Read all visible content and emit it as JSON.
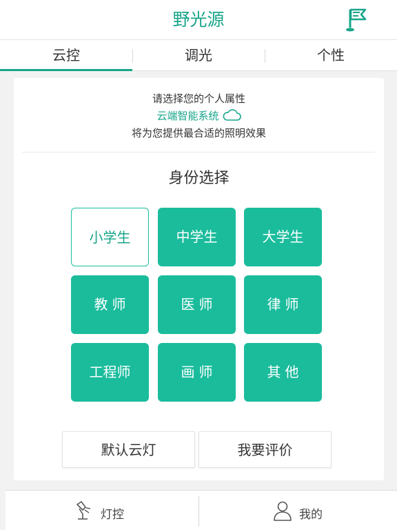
{
  "header": {
    "title": "野光源",
    "flag_icon": "flag-icon"
  },
  "tabs": [
    {
      "label": "云控",
      "active": true
    },
    {
      "label": "调光",
      "active": false
    },
    {
      "label": "个性",
      "active": false
    }
  ],
  "intro": {
    "line1": "请选择您的个人属性",
    "brand": "云端智能系统",
    "line3": "将为您提供最合适的照明效果"
  },
  "section_title": "身份选择",
  "identities": [
    {
      "label": "小学生",
      "selected": true
    },
    {
      "label": "中学生",
      "selected": false
    },
    {
      "label": "大学生",
      "selected": false
    },
    {
      "label": "教师",
      "selected": false
    },
    {
      "label": "医师",
      "selected": false
    },
    {
      "label": "律师",
      "selected": false
    },
    {
      "label": "工程师",
      "selected": false
    },
    {
      "label": "画师",
      "selected": false
    },
    {
      "label": "其他",
      "selected": false
    }
  ],
  "actions": {
    "default_label": "默认云灯",
    "review_label": "我要评价"
  },
  "bottom_nav": [
    {
      "label": "灯控",
      "icon": "lamp-icon"
    },
    {
      "label": "我的",
      "icon": "user-icon"
    }
  ],
  "colors": {
    "accent": "#1abc9c",
    "accent_text": "#17a589"
  }
}
